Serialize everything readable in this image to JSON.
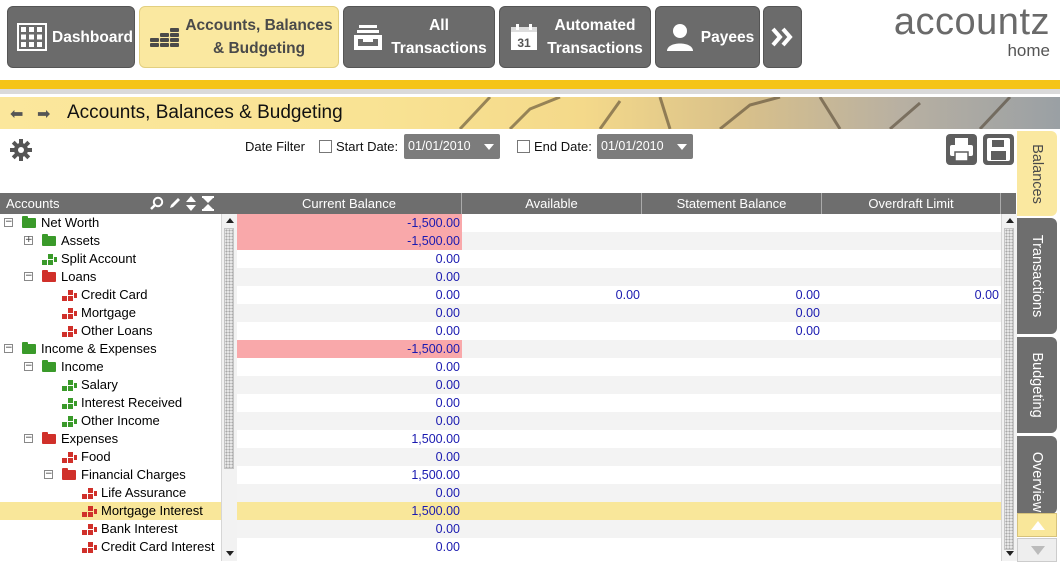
{
  "nav": {
    "dashboard": "Dashboard",
    "accounts_line1": "Accounts, Balances",
    "accounts_line2": "& Budgeting",
    "all_line1": "All",
    "all_line2": "Transactions",
    "auto_line1": "Automated",
    "auto_line2": "Transactions",
    "payees": "Payees",
    "more_icon": "double-chevron-right-icon",
    "calendar_day": "31"
  },
  "brand": {
    "name": "accountz",
    "edition": "home"
  },
  "page": {
    "title": "Accounts, Balances & Budgeting"
  },
  "filter": {
    "label": "Date Filter",
    "start_label": "Start Date:",
    "start_value": "01/01/2010",
    "end_label": "End Date:",
    "end_value": "01/01/2010"
  },
  "tree": {
    "header": "Accounts",
    "rows": [
      {
        "label": "Net Worth",
        "level": 0,
        "expander": "minus",
        "icon": "folder-green"
      },
      {
        "label": "Assets",
        "level": 1,
        "expander": "plus",
        "icon": "folder-green"
      },
      {
        "label": "Split Account",
        "level": 1,
        "expander": "",
        "icon": "blocks-green"
      },
      {
        "label": "Loans",
        "level": 1,
        "expander": "minus",
        "icon": "folder-red"
      },
      {
        "label": "Credit Card",
        "level": 2,
        "expander": "",
        "icon": "blocks-red"
      },
      {
        "label": "Mortgage",
        "level": 2,
        "expander": "",
        "icon": "blocks-red"
      },
      {
        "label": "Other Loans",
        "level": 2,
        "expander": "",
        "icon": "blocks-red"
      },
      {
        "label": "Income & Expenses",
        "level": 0,
        "expander": "minus",
        "icon": "folder-green"
      },
      {
        "label": "Income",
        "level": 1,
        "expander": "minus",
        "icon": "folder-green"
      },
      {
        "label": "Salary",
        "level": 2,
        "expander": "",
        "icon": "blocks-green"
      },
      {
        "label": "Interest Received",
        "level": 2,
        "expander": "",
        "icon": "blocks-green"
      },
      {
        "label": "Other Income",
        "level": 2,
        "expander": "",
        "icon": "blocks-green"
      },
      {
        "label": "Expenses",
        "level": 1,
        "expander": "minus",
        "icon": "folder-red"
      },
      {
        "label": "Food",
        "level": 2,
        "expander": "",
        "icon": "blocks-red"
      },
      {
        "label": "Financial Charges",
        "level": 2,
        "expander": "minus",
        "icon": "folder-red"
      },
      {
        "label": "Life Assurance",
        "level": 3,
        "expander": "",
        "icon": "blocks-red"
      },
      {
        "label": "Mortgage Interest",
        "level": 3,
        "expander": "",
        "icon": "blocks-red",
        "selected": true
      },
      {
        "label": "Bank Interest",
        "level": 3,
        "expander": "",
        "icon": "blocks-red"
      },
      {
        "label": "Credit Card Interest",
        "level": 3,
        "expander": "",
        "icon": "blocks-red"
      }
    ]
  },
  "grid": {
    "columns": [
      "Current Balance",
      "Available",
      "Statement Balance",
      "Overdraft Limit"
    ],
    "rows": [
      {
        "current": "-1,500.00",
        "available": "",
        "statement": "",
        "overdraft": "",
        "negative": true
      },
      {
        "current": "-1,500.00",
        "available": "",
        "statement": "",
        "overdraft": "",
        "negative": true
      },
      {
        "current": "0.00",
        "available": "",
        "statement": "",
        "overdraft": ""
      },
      {
        "current": "0.00",
        "available": "",
        "statement": "",
        "overdraft": ""
      },
      {
        "current": "0.00",
        "available": "0.00",
        "statement": "0.00",
        "overdraft": "0.00"
      },
      {
        "current": "0.00",
        "available": "",
        "statement": "0.00",
        "overdraft": ""
      },
      {
        "current": "0.00",
        "available": "",
        "statement": "0.00",
        "overdraft": ""
      },
      {
        "current": "-1,500.00",
        "available": "",
        "statement": "",
        "overdraft": "",
        "negative": true
      },
      {
        "current": "0.00",
        "available": "",
        "statement": "",
        "overdraft": ""
      },
      {
        "current": "0.00",
        "available": "",
        "statement": "",
        "overdraft": ""
      },
      {
        "current": "0.00",
        "available": "",
        "statement": "",
        "overdraft": ""
      },
      {
        "current": "0.00",
        "available": "",
        "statement": "",
        "overdraft": ""
      },
      {
        "current": "1,500.00",
        "available": "",
        "statement": "",
        "overdraft": ""
      },
      {
        "current": "0.00",
        "available": "",
        "statement": "",
        "overdraft": ""
      },
      {
        "current": "1,500.00",
        "available": "",
        "statement": "",
        "overdraft": ""
      },
      {
        "current": "0.00",
        "available": "",
        "statement": "",
        "overdraft": ""
      },
      {
        "current": "1,500.00",
        "available": "",
        "statement": "",
        "overdraft": "",
        "selected": true
      },
      {
        "current": "0.00",
        "available": "",
        "statement": "",
        "overdraft": ""
      },
      {
        "current": "0.00",
        "available": "",
        "statement": "",
        "overdraft": ""
      }
    ]
  },
  "side_tabs": [
    "Balances",
    "Transactions",
    "Budgeting",
    "Overview"
  ],
  "colors": {
    "nav_bg": "#6b6b6b",
    "nav_active": "#fae8a0",
    "accent_yellow": "#f5c417",
    "negative_bg": "#f9a8aa",
    "value_text": "#1a1ab0",
    "selection": "#f9e79a",
    "folder_green": "#3a9a2a",
    "folder_red": "#d0302a"
  }
}
